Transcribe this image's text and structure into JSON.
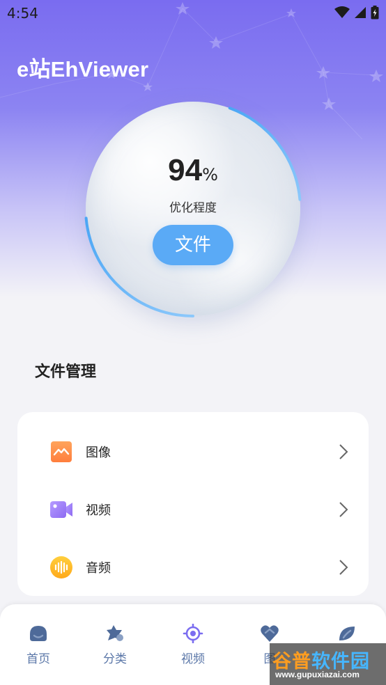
{
  "status_bar": {
    "time": "4:54",
    "icons": [
      "wifi-icon",
      "signal-icon",
      "battery-icon"
    ]
  },
  "header": {
    "title": "e站EhViewer"
  },
  "optimization": {
    "value": "94",
    "unit": "%",
    "label": "优化程度",
    "button_label": "文件",
    "progress_fraction": 0.94
  },
  "file_management": {
    "title": "文件管理",
    "items": [
      {
        "label": "图像",
        "icon": "image-icon"
      },
      {
        "label": "视频",
        "icon": "video-icon"
      },
      {
        "label": "音频",
        "icon": "audio-icon"
      }
    ]
  },
  "tabbar": {
    "tabs": [
      {
        "label": "首页",
        "icon": "home-icon"
      },
      {
        "label": "分类",
        "icon": "category-icon"
      },
      {
        "label": "视频",
        "icon": "video-tab-icon",
        "active": true
      },
      {
        "label": "图",
        "icon": "gallery-icon"
      },
      {
        "label": "",
        "icon": "leaf-icon"
      }
    ]
  },
  "watermark": {
    "text_part1": "谷普",
    "text_part2": "软件园",
    "url": "www.gupuxiazai.com"
  },
  "colors": {
    "accent": "#5aaaf6",
    "header_gradient_top": "#7a6cf0",
    "tab_text": "#5b77a8",
    "active_tab_icon": "#7b6df0"
  }
}
